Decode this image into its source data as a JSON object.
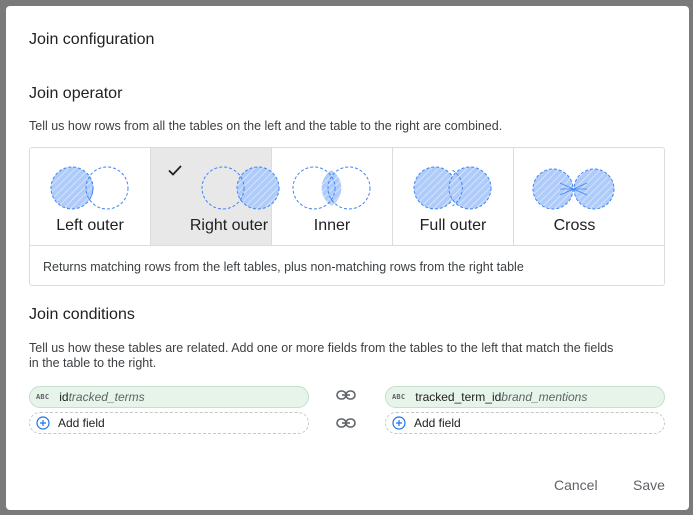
{
  "dialog": {
    "title": "Join configuration"
  },
  "operator_section": {
    "title": "Join operator",
    "description": "Tell us how rows from all the tables on the left and the table to the right are combined.",
    "operators": [
      {
        "label": "Left outer",
        "selected": false
      },
      {
        "label": "Right outer",
        "selected": true
      },
      {
        "label": "Inner",
        "selected": false
      },
      {
        "label": "Full outer",
        "selected": false
      },
      {
        "label": "Cross",
        "selected": false
      }
    ],
    "selected_description": "Returns matching rows from the left tables, plus non-matching rows from the right table"
  },
  "conditions_section": {
    "title": "Join conditions",
    "description_line1": "Tell us how these tables are related. Add one or more fields from the tables to the left that match the fields",
    "description_line2": "in the table to the right.",
    "left": {
      "type_badge": "ABC",
      "field": "id",
      "table": "tracked_terms",
      "add_label": "Add field"
    },
    "right": {
      "type_badge": "ABC",
      "field": "tracked_term_id",
      "table": "brand_mentions",
      "add_label": "Add field"
    }
  },
  "footer": {
    "cancel_label": "Cancel",
    "save_label": "Save"
  },
  "colors": {
    "venn_fill": "#aecbfa",
    "venn_stroke": "#4285f4",
    "selected_bg": "#e8e8e8",
    "field_bg": "#e6f4ea",
    "accent_blue": "#1a73e8"
  }
}
